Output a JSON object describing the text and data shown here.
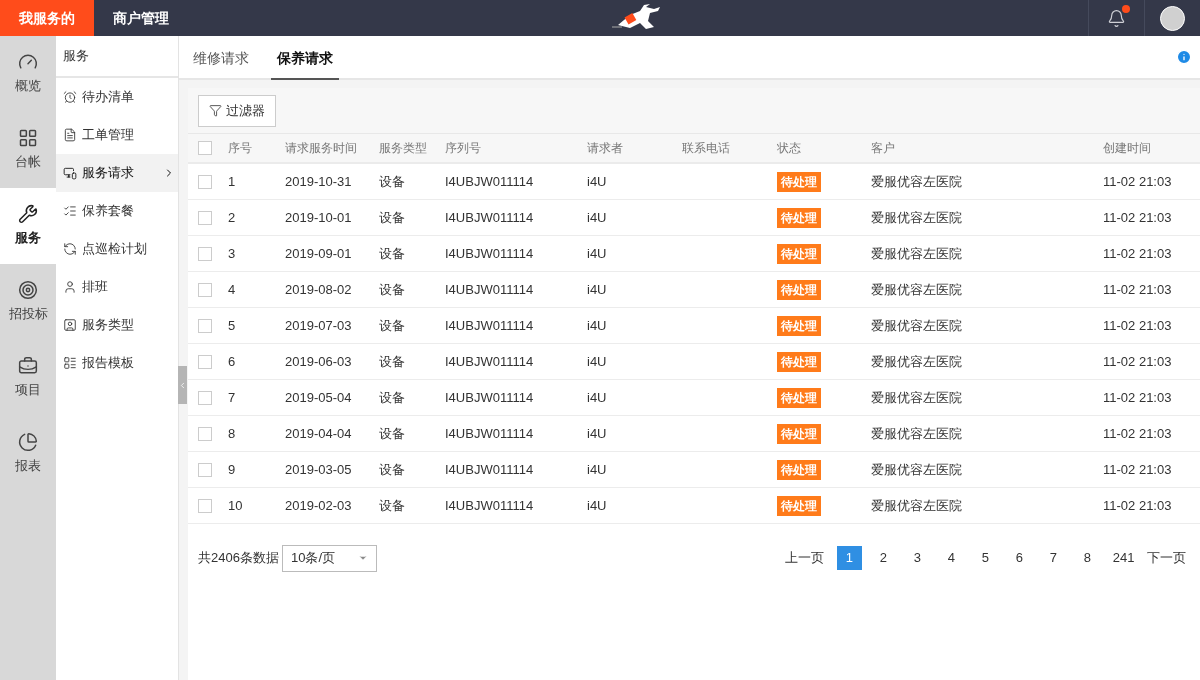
{
  "top_nav": [
    {
      "label": "我服务的",
      "selected": true
    },
    {
      "label": "商户管理",
      "selected": false
    }
  ],
  "notifications": {
    "unread": true
  },
  "rail": [
    {
      "label": "概览",
      "selected": false
    },
    {
      "label": "台帐",
      "selected": false
    },
    {
      "label": "服务",
      "selected": true
    },
    {
      "label": "招投标",
      "selected": false
    },
    {
      "label": "项目",
      "selected": false
    },
    {
      "label": "报表",
      "selected": false
    }
  ],
  "sidebar": {
    "title": "服务",
    "items": [
      {
        "label": "待办清单",
        "selected": false
      },
      {
        "label": "工单管理",
        "selected": false
      },
      {
        "label": "服务请求",
        "selected": true,
        "has_submenu": true
      },
      {
        "label": "保养套餐",
        "selected": false
      },
      {
        "label": "点巡检计划",
        "selected": false
      },
      {
        "label": "排班",
        "selected": false
      },
      {
        "label": "服务类型",
        "selected": false
      },
      {
        "label": "报告模板",
        "selected": false
      }
    ]
  },
  "tabs": [
    {
      "label": "维修请求",
      "selected": false
    },
    {
      "label": "保养请求",
      "selected": true
    }
  ],
  "filter_button": "过滤器",
  "table": {
    "all_checked": false,
    "columns": [
      "序号",
      "请求服务时间",
      "服务类型",
      "序列号",
      "请求者",
      "联系电话",
      "状态",
      "客户",
      "创建时间"
    ],
    "rows": [
      {
        "checked": false,
        "cells": [
          "1",
          "2019-10-31",
          "设备",
          "I4UBJW011114",
          "i4U",
          "",
          "待处理",
          "爱服优容左医院",
          "11-02 21:03"
        ]
      },
      {
        "checked": false,
        "cells": [
          "2",
          "2019-10-01",
          "设备",
          "I4UBJW011114",
          "i4U",
          "",
          "待处理",
          "爱服优容左医院",
          "11-02 21:03"
        ]
      },
      {
        "checked": false,
        "cells": [
          "3",
          "2019-09-01",
          "设备",
          "I4UBJW011114",
          "i4U",
          "",
          "待处理",
          "爱服优容左医院",
          "11-02 21:03"
        ]
      },
      {
        "checked": false,
        "cells": [
          "4",
          "2019-08-02",
          "设备",
          "I4UBJW011114",
          "i4U",
          "",
          "待处理",
          "爱服优容左医院",
          "11-02 21:03"
        ]
      },
      {
        "checked": false,
        "cells": [
          "5",
          "2019-07-03",
          "设备",
          "I4UBJW011114",
          "i4U",
          "",
          "待处理",
          "爱服优容左医院",
          "11-02 21:03"
        ]
      },
      {
        "checked": false,
        "cells": [
          "6",
          "2019-06-03",
          "设备",
          "I4UBJW011114",
          "i4U",
          "",
          "待处理",
          "爱服优容左医院",
          "11-02 21:03"
        ]
      },
      {
        "checked": false,
        "cells": [
          "7",
          "2019-05-04",
          "设备",
          "I4UBJW011114",
          "i4U",
          "",
          "待处理",
          "爱服优容左医院",
          "11-02 21:03"
        ]
      },
      {
        "checked": false,
        "cells": [
          "8",
          "2019-04-04",
          "设备",
          "I4UBJW011114",
          "i4U",
          "",
          "待处理",
          "爱服优容左医院",
          "11-02 21:03"
        ]
      },
      {
        "checked": false,
        "cells": [
          "9",
          "2019-03-05",
          "设备",
          "I4UBJW011114",
          "i4U",
          "",
          "待处理",
          "爱服优容左医院",
          "11-02 21:03"
        ]
      },
      {
        "checked": false,
        "cells": [
          "10",
          "2019-02-03",
          "设备",
          "I4UBJW011114",
          "i4U",
          "",
          "待处理",
          "爱服优容左医院",
          "11-02 21:03"
        ]
      }
    ]
  },
  "footer": {
    "total": "共2406条数据",
    "page_size": "10条/页",
    "prev": "上一页",
    "next": "下一页",
    "pages": [
      {
        "label": "1",
        "selected": true
      },
      {
        "label": "2",
        "selected": false
      },
      {
        "label": "3",
        "selected": false
      },
      {
        "label": "4",
        "selected": false
      },
      {
        "label": "5",
        "selected": false
      },
      {
        "label": "6",
        "selected": false
      },
      {
        "label": "7",
        "selected": false
      },
      {
        "label": "8",
        "selected": false
      },
      {
        "label": "241",
        "selected": false
      }
    ]
  }
}
